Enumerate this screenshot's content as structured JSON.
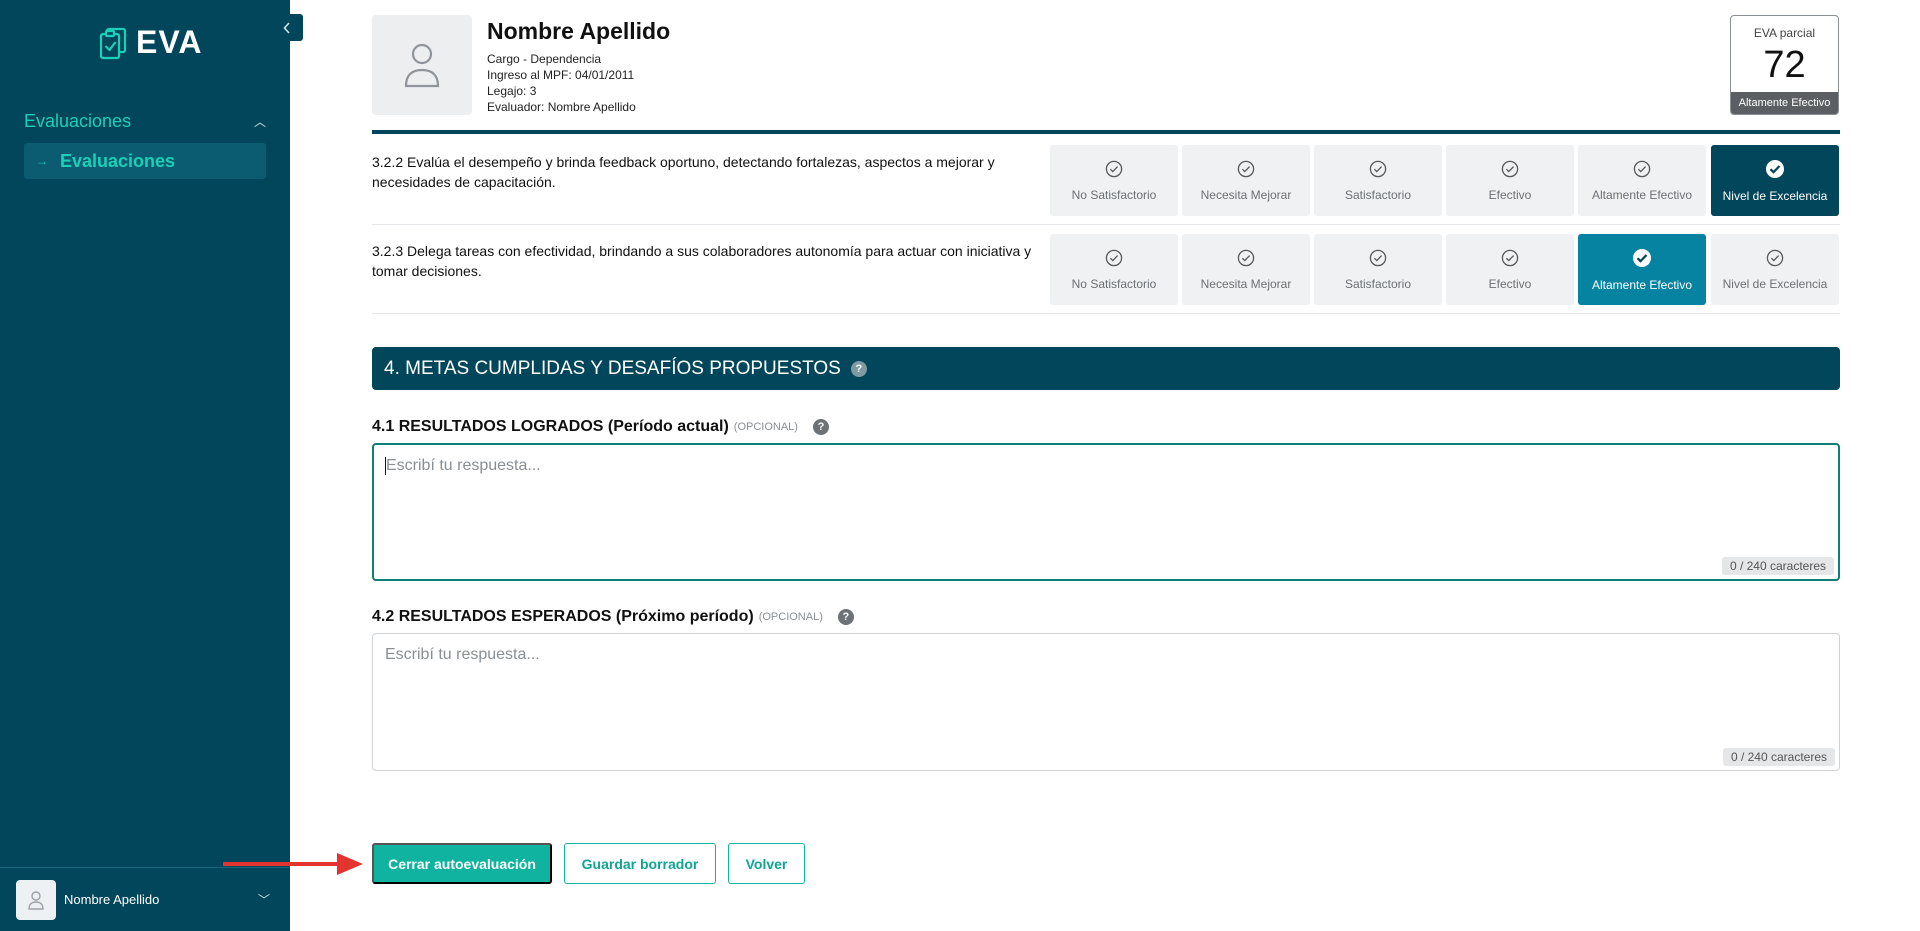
{
  "sidebar": {
    "logo_text": "EVA",
    "group_label": "Evaluaciones",
    "active_item_label": "Evaluaciones",
    "user_name": "Nombre Apellido"
  },
  "profile": {
    "name": "Nombre Apellido",
    "position": "Cargo - Dependencia",
    "entry": "Ingreso al MPF: 04/01/2011",
    "file": "Legajo: 3",
    "evaluator": "Evaluador: Nombre Apellido"
  },
  "score": {
    "label": "EVA parcial",
    "value": "72",
    "badge": "Altamente Efectivo"
  },
  "rating_options": [
    "No Satisfactorio",
    "Necesita Mejorar",
    "Satisfactorio",
    "Efectivo",
    "Altamente Efectivo",
    "Nivel de Excelencia"
  ],
  "questions": [
    {
      "text": "3.2.2 Evalúa el desempeño y brinda feedback oportuno, detectando fortalezas, aspectos a mejorar y necesidades de capacitación.",
      "selected": "Nivel de Excelencia"
    },
    {
      "text": "3.2.3 Delega tareas con efectividad, brindando a sus colaboradores autonomía para actuar con iniciativa y tomar decisiones.",
      "selected": "Altamente Efectivo"
    }
  ],
  "section4": {
    "title": "4. METAS CUMPLIDAS Y DESAFÍOS PROPUESTOS",
    "field1": {
      "title": "4.1 RESULTADOS LOGRADOS (Período actual)",
      "optional": "(OPCIONAL)",
      "placeholder": "Escribí tu respuesta...",
      "counter": "0 / 240 caracteres"
    },
    "field2": {
      "title": "4.2 RESULTADOS ESPERADOS (Próximo período)",
      "optional": "(OPCIONAL)",
      "placeholder": "Escribí tu respuesta...",
      "counter": "0 / 240 caracteres"
    }
  },
  "actions": {
    "close_label": "Cerrar autoevaluación",
    "draft_label": "Guardar borrador",
    "back_label": "Volver"
  },
  "colors": {
    "sidebar": "#01465a",
    "accent": "#1ccfb8",
    "primary_button": "#0fb3a0",
    "selected_dark": "#01465a",
    "selected_light": "#0683a1",
    "annotation_arrow": "#e3342f"
  }
}
